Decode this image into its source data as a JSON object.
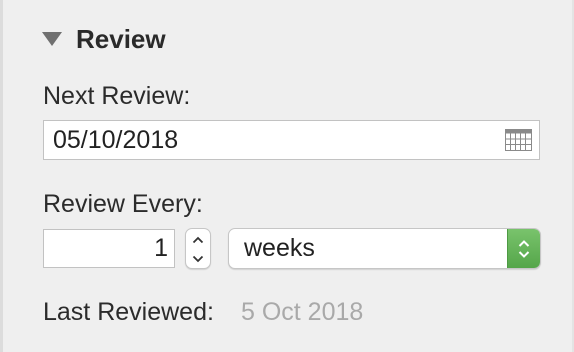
{
  "section": {
    "title": "Review",
    "expanded": true
  },
  "next_review": {
    "label": "Next Review:",
    "value": "05/10/2018",
    "picker_icon": "calendar-icon"
  },
  "review_every": {
    "label": "Review Every:",
    "count": "1",
    "unit": "weeks",
    "stepper_icon": "up-down-stepper-icon",
    "popup_icon": "chevron-up-down-icon"
  },
  "last_reviewed": {
    "label": "Last Reviewed:",
    "value": "5 Oct 2018"
  },
  "colors": {
    "popup_accent": "#5cae4f",
    "background": "#efefef",
    "muted_text": "#a9a9a9"
  }
}
